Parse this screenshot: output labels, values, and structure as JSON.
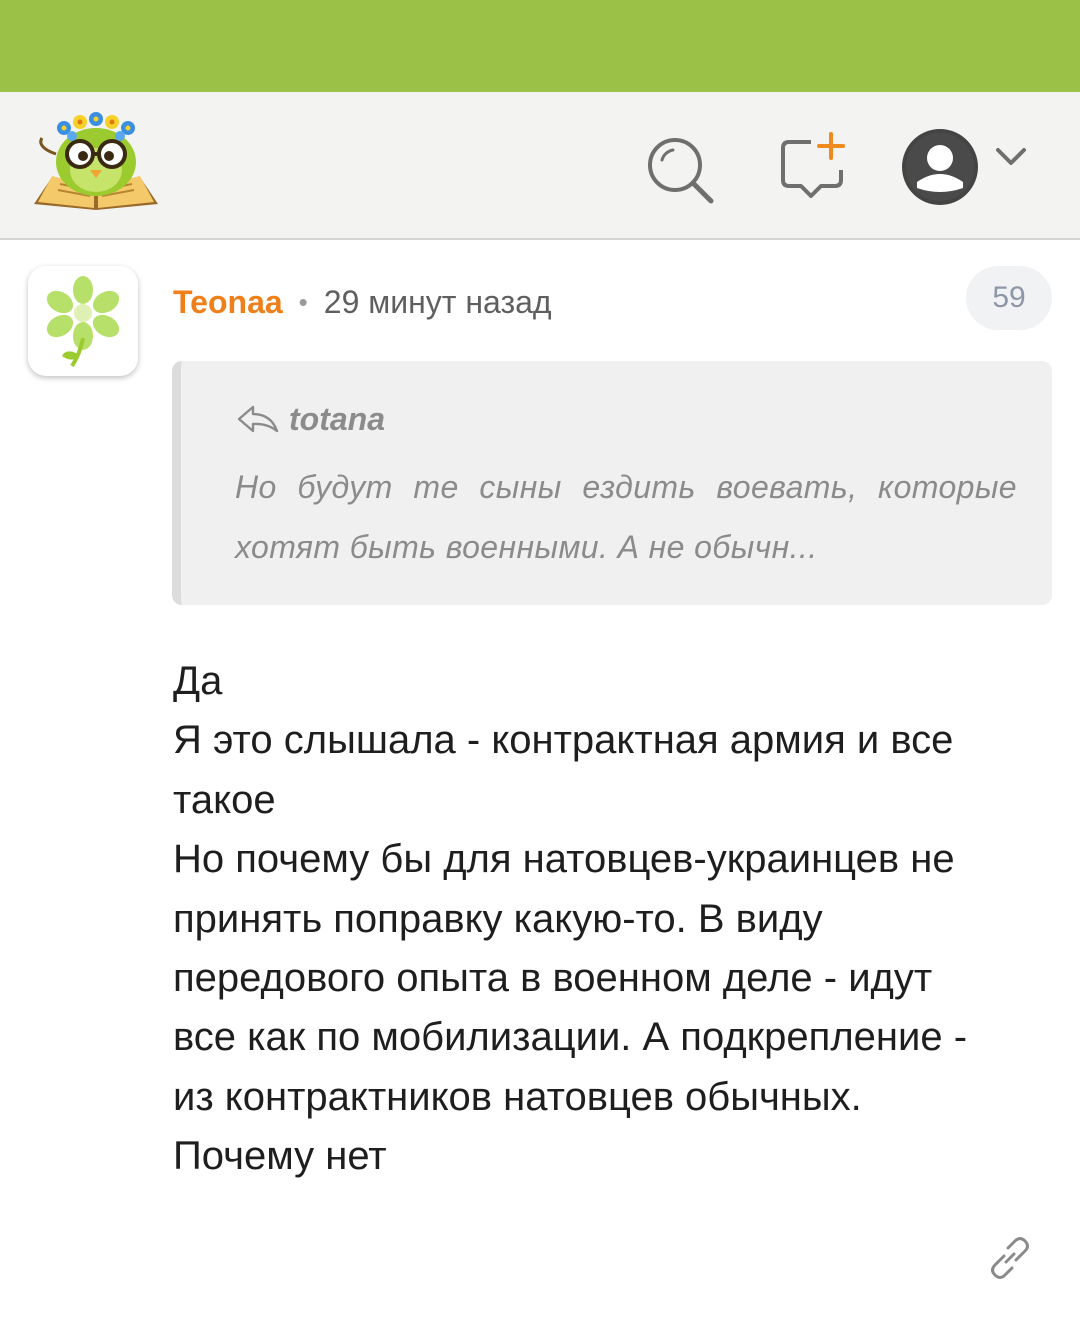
{
  "colors": {
    "status_bar": "#9bc147",
    "header_bg": "#f3f4f1",
    "author": "#ef7f1a",
    "quote_bg": "#f0f0f0",
    "quote_text": "#8b8b8b",
    "badge_text": "#8e97a7"
  },
  "header": {
    "logo_icon": "owl-on-book-logo",
    "search_icon": "search-icon",
    "new_post_icon": "new-post-icon",
    "profile_icon": "user-avatar-icon",
    "menu_icon": "chevron-down-icon"
  },
  "comment": {
    "avatar_icon": "flower-avatar",
    "author": "Teonaa",
    "separator": "•",
    "time": "29 минут назад",
    "count": "59",
    "quote": {
      "icon": "reply-arrow-icon",
      "author": "totana",
      "text": "Но будут те сыны ездить воевать, которые хотят быть военными. А не обычн..."
    },
    "lines": [
      "Да",
      "Я это слышала - контрактная армия и все",
      "такое",
      "Но почему бы для натовцев-украинцев не",
      "принять поправку какую-то. В виду",
      "передового опыта в военном деле - идут",
      "все как по мобилизации. А подкрепление -",
      "из контрактников натовцев обычных.",
      "Почему нет"
    ],
    "link_icon": "link-icon"
  }
}
